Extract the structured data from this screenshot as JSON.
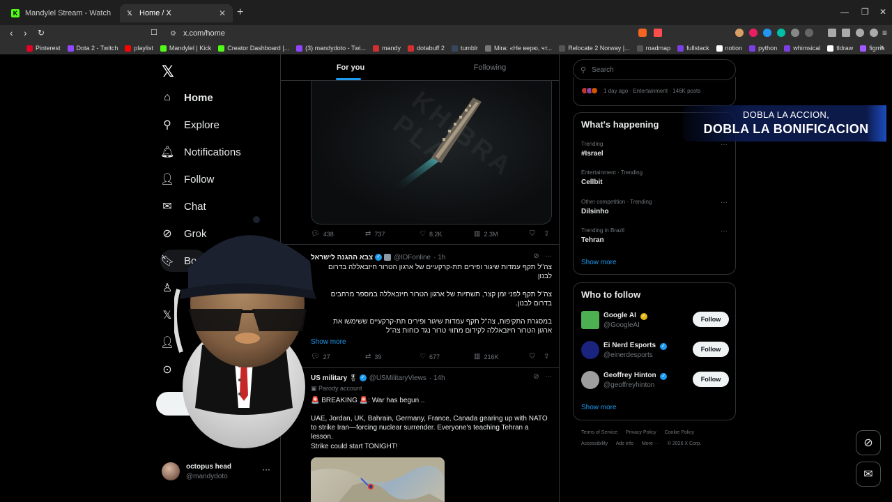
{
  "browser": {
    "tabs": [
      {
        "title": "Mandylel Stream - Watch Live on Kick",
        "favicon": "kick-icon",
        "color": "#53fc18"
      },
      {
        "title": "Home / X",
        "favicon": "x-icon",
        "color": "#ffffff"
      }
    ],
    "url": "x.com/home",
    "bookmarks": [
      {
        "label": "Pinterest",
        "color": "#e60023"
      },
      {
        "label": "Dota 2 - Twitch",
        "color": "#9146ff"
      },
      {
        "label": "playlist",
        "color": "#ff0000"
      },
      {
        "label": "Mandylel | Kick",
        "color": "#53fc18"
      },
      {
        "label": "Creator Dashboard |...",
        "color": "#53fc18"
      },
      {
        "label": "(3) mandydoto - Twi...",
        "color": "#9146ff"
      },
      {
        "label": "mandy",
        "color": "#d32f2f"
      },
      {
        "label": "dotabuff 2",
        "color": "#d32f2f"
      },
      {
        "label": "tumblr",
        "color": "#36465d"
      },
      {
        "label": "Mira: «Не верю, чт...",
        "color": "#777777"
      },
      {
        "label": "Relocate 2 Norway |...",
        "color": "#555555"
      },
      {
        "label": "roadmap",
        "color": "#555555"
      },
      {
        "label": "fullstack",
        "color": "#7b3fe4"
      },
      {
        "label": "notion",
        "color": "#ffffff"
      },
      {
        "label": "python",
        "color": "#7b3fe4"
      },
      {
        "label": "whimsical",
        "color": "#7b3fe4"
      },
      {
        "label": "tldraw",
        "color": "#ffffff"
      },
      {
        "label": "figma",
        "color": "#a259ff"
      }
    ]
  },
  "nav": {
    "items": [
      {
        "label": "Home",
        "icon": "home-icon"
      },
      {
        "label": "Explore",
        "icon": "search-icon"
      },
      {
        "label": "Notifications",
        "icon": "bell-icon"
      },
      {
        "label": "Follow",
        "icon": "person-add-icon"
      },
      {
        "label": "Chat",
        "icon": "mail-icon"
      },
      {
        "label": "Grok",
        "icon": "grok-icon"
      },
      {
        "label": "Bo",
        "icon": "bookmark-icon"
      }
    ],
    "profile": {
      "name": "octopus head",
      "handle": "@mandydoto"
    }
  },
  "feed": {
    "tabs": [
      "For you",
      "Following"
    ],
    "tweet1": {
      "replies": "438",
      "reposts": "737",
      "likes": "8.2K",
      "views": "2.3M"
    },
    "tweet2": {
      "name": "צבא ההגנה לישראל",
      "handle": "@IDFonline",
      "time": "· 1h",
      "lines": [
        "צה\"ל תקף עמדות שיגור ופירים תת-קרקעיים של ארגון הטרור חיזבאללה בדרום",
        "לבנון",
        "צה\"ל תקף לפני זמן קצר, תשתיות של ארגון הטרור חיזבאללה במספר מרחבים",
        "בדרום לבנון.",
        "במסגרת התקיפות, צה\"ל תקף עמדות שיגור ופירים תת-קרקעיים ששימשו את",
        "ארגון הטרור חיזבאללה לקידום מתווי טרור נגד כוחות צה\"ל"
      ],
      "show_more": "Show more",
      "replies": "27",
      "reposts": "39",
      "likes": "677",
      "views": "216K"
    },
    "tweet3": {
      "name": "US military",
      "handle": "@USMilitaryViews",
      "time": "· 14h",
      "parody": "Parody account",
      "breaking": "🚨 BREAKING 🚨: War has begun ..",
      "body": "UAE, Jordan, UK, Bahrain, Germany, France, Canada gearing up with NATO to strike Iran—forcing nuclear surrender. Everyone's teaching Tehran a lesson.",
      "tail": "Strike could start TONIGHT!"
    }
  },
  "sidebar": {
    "search_placeholder": "Search",
    "top_trend": "1 day ago · Entertainment · 146K posts",
    "happening_title": "What's happening",
    "trends": [
      {
        "category": "Trending",
        "name": "#Israel"
      },
      {
        "category": "Entertainment · Trending",
        "name": "Cellbit"
      },
      {
        "category": "Other competition · Trending",
        "name": "Dilsinho"
      },
      {
        "category": "Trending in Brazil",
        "name": "Tehran"
      }
    ],
    "show_more": "Show more",
    "wtf_title": "Who to follow",
    "follow_label": "Follow",
    "who_to_follow": [
      {
        "name": "Google AI",
        "handle": "@GoogleAI",
        "color": "#4caf50"
      },
      {
        "name": "Ei Nerd Esports",
        "handle": "@einerdesports",
        "color": "#1a237e"
      },
      {
        "name": "Geoffrey Hinton",
        "handle": "@geoffreyhinton",
        "color": "#9e9e9e"
      }
    ],
    "footer": [
      "Terms of Service",
      "Privacy Policy",
      "Cookie Policy",
      "Accessibility",
      "Ads info",
      "More ···",
      "© 2026 X Corp."
    ]
  },
  "overlay": {
    "promo_line1": "DOBLA LA ACCION,",
    "promo_line2": "DOBLA LA BONIFICACION"
  }
}
